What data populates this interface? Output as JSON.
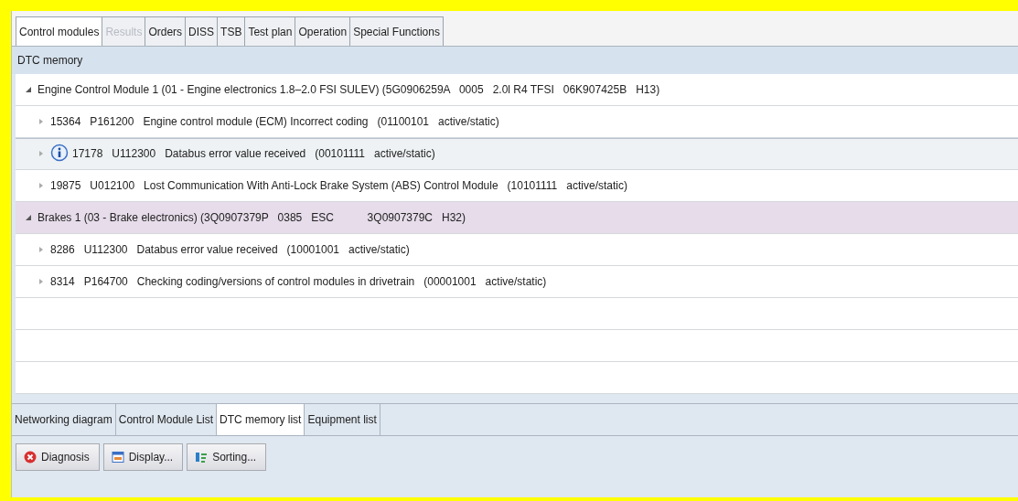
{
  "tabs": [
    {
      "label": "Control modules",
      "selected": true,
      "disabled": false
    },
    {
      "label": "Results",
      "selected": false,
      "disabled": true
    },
    {
      "label": "Orders",
      "selected": false,
      "disabled": false
    },
    {
      "label": "DISS",
      "selected": false,
      "disabled": false
    },
    {
      "label": "TSB",
      "selected": false,
      "disabled": false
    },
    {
      "label": "Test plan",
      "selected": false,
      "disabled": false
    },
    {
      "label": "Operation",
      "selected": false,
      "disabled": false
    },
    {
      "label": "Special Functions",
      "selected": false,
      "disabled": false
    }
  ],
  "panel_title": "DTC memory",
  "rows": [
    {
      "kind": "group",
      "text": "Engine Control Module 1 (01 - Engine electronics 1.8–2.0 FSI SULEV) (5G0906259A   0005   2.0l R4 TFSI   06K907425B   H13)",
      "expanded": true,
      "selected": false,
      "hovered": false
    },
    {
      "kind": "dtc",
      "text": "15364   P161200   Engine control module (ECM) Incorrect coding   (01100101   active/static)",
      "expanded": false,
      "selected": false,
      "hovered": false,
      "info": false
    },
    {
      "kind": "dtc",
      "text": "17178   U112300   Databus error value received   (00101111   active/static)",
      "expanded": false,
      "selected": false,
      "hovered": true,
      "info": true
    },
    {
      "kind": "dtc",
      "text": "19875   U012100   Lost Communication With Anti-Lock Brake System (ABS) Control Module   (10101111   active/static)",
      "expanded": false,
      "selected": false,
      "hovered": false,
      "info": false
    },
    {
      "kind": "group",
      "text": "Brakes 1 (03 - Brake electronics) (3Q0907379P   0385   ESC           3Q0907379C   H32)",
      "expanded": true,
      "selected": true,
      "hovered": false
    },
    {
      "kind": "dtc",
      "text": "8286   U112300   Databus error value received   (10001001   active/static)",
      "expanded": false,
      "selected": false,
      "hovered": false,
      "info": false
    },
    {
      "kind": "dtc",
      "text": "8314   P164700   Checking coding/versions of control modules in drivetrain   (00001001   active/static)",
      "expanded": false,
      "selected": false,
      "hovered": false,
      "info": false
    }
  ],
  "bottom_tabs": [
    {
      "label": "Networking diagram",
      "selected": false
    },
    {
      "label": "Control Module List",
      "selected": false
    },
    {
      "label": "DTC memory list",
      "selected": true
    },
    {
      "label": "Equipment list",
      "selected": false
    }
  ],
  "buttons": [
    "Diagnosis",
    "Display...",
    "Sorting..."
  ]
}
